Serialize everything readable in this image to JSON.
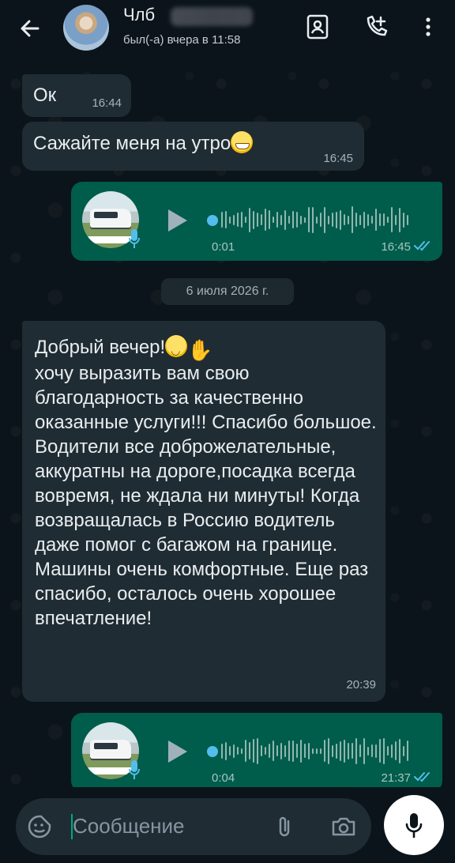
{
  "header": {
    "contact_name": "Члб",
    "status": "был(-а) вчера в 11:58",
    "icons": [
      "back-arrow-icon",
      "contact-card-icon",
      "add-call-icon",
      "more-vertical-icon"
    ]
  },
  "messages": [
    {
      "id": "m1",
      "direction": "incoming",
      "text": "Ок",
      "time": "16:44"
    },
    {
      "id": "m2",
      "direction": "incoming",
      "text": "Сажайте меня на утро",
      "time": "16:45",
      "emoji": "grinning-face"
    },
    {
      "id": "m3",
      "direction": "outgoing",
      "type": "voice",
      "duration": "0:01",
      "time": "16:45",
      "status": "read"
    },
    {
      "id": "m4",
      "direction": "incoming",
      "greeting": "Добрый вечер!",
      "emojis": [
        "slightly-smiling-face",
        "waving-hand"
      ],
      "text": "хочу выразить вам свою благодарность за качественно оказанные услуги!!! Спасибо большое. Водители все доброжелательные, аккуратны на дороге,посадка всегда вовремя, не ждала ни минуты! Когда возвращалась в Россию водитель даже помог с багажом на границе. Машины очень комфортные. Еще раз спасибо, осталось очень хорошее впечатление!",
      "time": "20:39"
    },
    {
      "id": "m5",
      "direction": "outgoing",
      "type": "voice",
      "duration": "0:04",
      "time": "21:37",
      "status": "read"
    }
  ],
  "date_separator": "6 июля 2026 г.",
  "composer": {
    "placeholder": "Сообщение",
    "icons": [
      "sticker-icon",
      "attach-icon",
      "camera-icon",
      "mic-icon"
    ]
  },
  "colors": {
    "background": "#0b141a",
    "incoming_bubble": "#1f2c34",
    "outgoing_bubble": "#005c4b",
    "read_ticks": "#53bdeb",
    "accent": "#00a884"
  }
}
